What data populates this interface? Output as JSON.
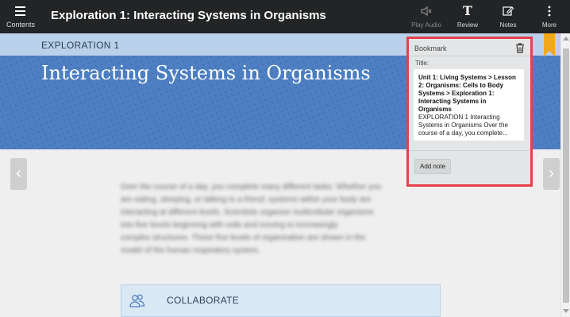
{
  "header": {
    "menu_label": "Contents",
    "title": "Exploration 1: Interacting Systems in Organisms",
    "tools": [
      {
        "label": "Play Audio",
        "icon": "speaker-icon",
        "enabled": false
      },
      {
        "label": "Review",
        "icon": "text-T-icon",
        "enabled": true
      },
      {
        "label": "Notes",
        "icon": "pencil-note-icon",
        "enabled": true
      },
      {
        "label": "More",
        "icon": "vertical-dots-icon",
        "enabled": true
      }
    ]
  },
  "section": {
    "label": "EXPLORATION 1",
    "heading": "Interacting Systems in Organisms"
  },
  "body": {
    "blurred_paragraph": [
      "Over the course of a day, you complete many different tasks. Whether you",
      "are eating, sleeping, or talking to a friend, systems within your body are",
      "interacting at different levels. Scientists organize multicellular organisms",
      "into five levels beginning with cells and moving to increasingly",
      "complex structures. These five levels of organization are shown in the",
      "model of the human respiratory system."
    ],
    "collaborate_label": "COLLABORATE"
  },
  "bookmark_panel": {
    "heading": "Bookmark",
    "title_label": "Title:",
    "path_text": "Unit 1: Living Systems > Lesson 2: Organisms: Cells to Body Systems > Exploration 1: Interacting Systems in Organisms",
    "excerpt_text": "EXPLORATION 1 Interacting Systems in Organisms Over the course of a day, you complete...",
    "add_note_label": "Add note"
  },
  "colors": {
    "topbar": "#222426",
    "hero_blue": "#4d7fc2",
    "label_strip": "#b9d1ea",
    "highlight_red": "#e8404b",
    "bookmark_ribbon": "#f2a81d"
  }
}
